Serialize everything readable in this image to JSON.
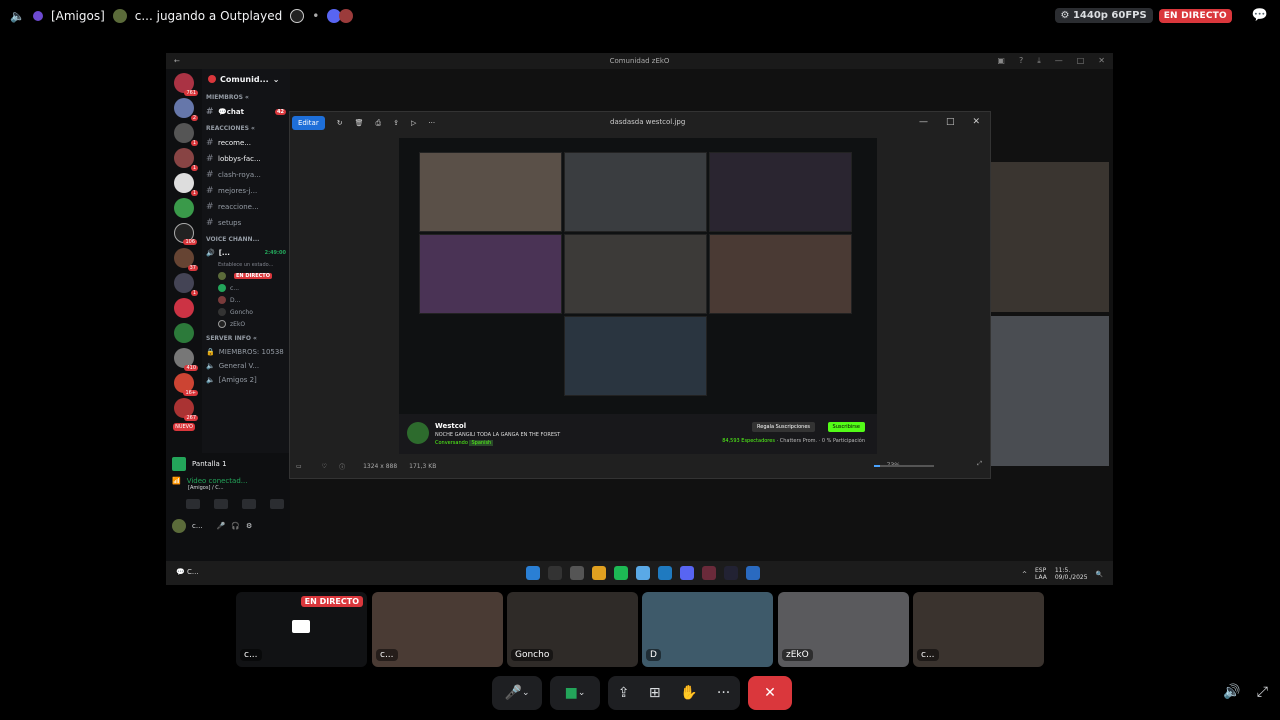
{
  "header": {
    "channel": "[Amigos]",
    "activity": "c... jugando a Outplayed",
    "quality": "1440p 60FPS",
    "live": "EN DIRECTO"
  },
  "window": {
    "title": "Comunidad zEkO"
  },
  "server": {
    "name": "Comunid...",
    "rail_counts": [
      "761",
      "2",
      "1",
      "1",
      "1",
      "106",
      "37",
      "1",
      "410",
      "1",
      "16+",
      "267"
    ],
    "rail_new": "NUEVO",
    "categories": [
      "MIEMBROS «",
      "REACCIONES «",
      "VOICE CHANN...",
      "Server Info «"
    ],
    "channels_top": [
      {
        "name": "💬chat",
        "badge": "42",
        "active": true
      }
    ],
    "channels_reacciones": [
      {
        "name": "recome..."
      },
      {
        "name": "lobbys-fac..."
      },
      {
        "name": "clash-roya..."
      },
      {
        "name": "mejores-j..."
      },
      {
        "name": "reaccione..."
      },
      {
        "name": "setups"
      }
    ],
    "voice_channel": {
      "name": "[...",
      "time": "2:49:00",
      "status": "Establece un estado..."
    },
    "voice_users": [
      {
        "name": "",
        "live": "EN DIRECTO"
      },
      {
        "name": "c..."
      },
      {
        "name": "D..."
      },
      {
        "name": "Goncho"
      },
      {
        "name": "zEkO"
      }
    ],
    "info_channels": [
      "MIEMBROS: 10538",
      "General V...",
      "[Amigos 2]"
    ]
  },
  "user_panel": {
    "stream": "Pantalla 1",
    "connected": "Video conectad...",
    "sub": "[Amigos] / C...",
    "user": "c..."
  },
  "viewer": {
    "edit": "Editar",
    "filename": "dasdasda westcol.jpg",
    "dimensions": "1324 x 888",
    "size": "171,3 KB",
    "zoom": "73%",
    "zoom_level": 0.1
  },
  "stream_overlay": {
    "streamer": "Westcol",
    "title": "NOCHE GANGILI TODA LA GANGA EN THE FOREST",
    "category": "Conversando",
    "language": "Spanish",
    "gift": "Regala Suscripciones",
    "subscribe": "Suscribirse",
    "viewers": "84,593 Espectadores",
    "chat_mode": "Chatters Prom.",
    "participation": "0 % Participación"
  },
  "taskbar": {
    "left": "C...",
    "lang": "ESP",
    "region": "LAA",
    "time": "11:5.",
    "date": "09/0./2025"
  },
  "tiles": [
    {
      "name": "c...",
      "live": "EN DIRECTO",
      "screen": true
    },
    {
      "name": "c..."
    },
    {
      "name": "Goncho"
    },
    {
      "name": "D"
    },
    {
      "name": "zEkO"
    },
    {
      "name": "c..."
    }
  ],
  "colors": {
    "accent": "#5865f2",
    "danger": "#da373c",
    "success": "#23a55a",
    "kick_green": "#53fc18"
  }
}
